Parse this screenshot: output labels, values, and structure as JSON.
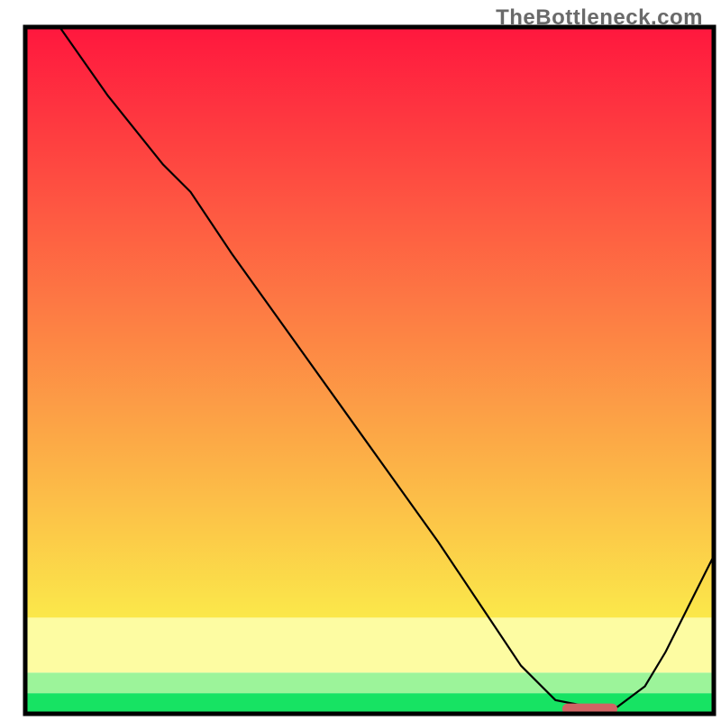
{
  "watermark": "TheBottleneck.com",
  "chart_data": {
    "type": "line",
    "title": "",
    "xlabel": "",
    "ylabel": "",
    "xlim": [
      0,
      100
    ],
    "ylim": [
      0,
      100
    ],
    "grid": false,
    "legend": false,
    "annotations": [],
    "background_bands": [
      {
        "name": "green",
        "y0": 0,
        "y1": 3,
        "color": "#17e363"
      },
      {
        "name": "pale-green",
        "y0": 3,
        "y1": 6,
        "color": "#9cf49a"
      },
      {
        "name": "pale-yellow",
        "y0": 6,
        "y1": 14,
        "color": "#fdfca2"
      },
      {
        "name": "gradient",
        "y0": 14,
        "y1": 100,
        "color_top": "#ff173e",
        "color_bottom": "#fbe84a"
      }
    ],
    "series": [
      {
        "name": "bottleneck-curve",
        "color": "#000000",
        "x": [
          5,
          12,
          20,
          24,
          30,
          40,
          50,
          60,
          68,
          72,
          77,
          82,
          86,
          90,
          93,
          96,
          100
        ],
        "y": [
          100,
          90,
          80,
          76,
          67,
          53,
          39,
          25,
          13,
          7,
          2,
          1,
          1,
          4,
          9,
          15,
          23
        ]
      }
    ],
    "marker": {
      "name": "optimum-marker",
      "color": "#d06464",
      "x0": 78,
      "x1": 86,
      "y": 0.7,
      "thickness_px": 12
    }
  }
}
